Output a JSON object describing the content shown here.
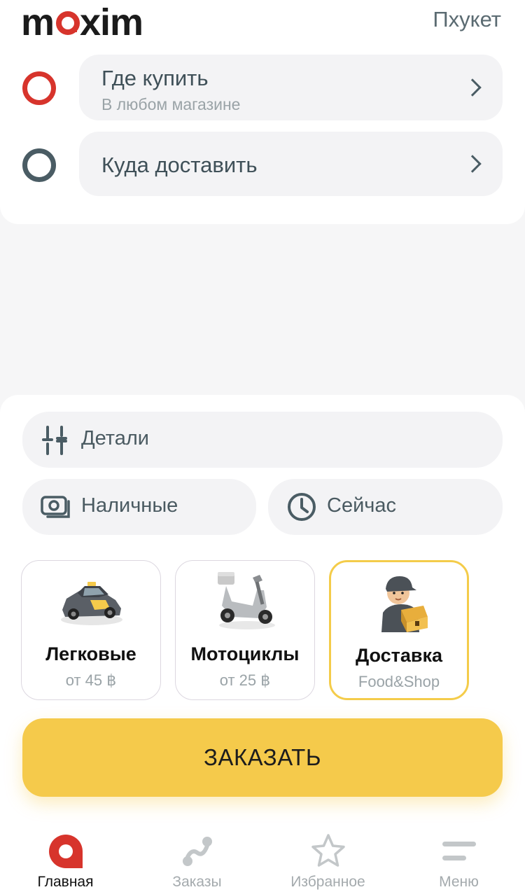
{
  "header": {
    "logo_text": "maxim",
    "city": "Пхукет"
  },
  "route": {
    "from": {
      "title": "Где купить",
      "subtitle": "В любом магазине"
    },
    "to": {
      "title": "Куда доставить"
    }
  },
  "options": {
    "details_label": "Детали",
    "payment_label": "Наличные",
    "time_label": "Сейчас"
  },
  "tariffs": [
    {
      "name": "Легковые",
      "price": "от 45 ฿",
      "icon": "car-icon"
    },
    {
      "name": "Мотоциклы",
      "price": "от 25 ฿",
      "icon": "scooter-icon"
    },
    {
      "name": "Доставка",
      "price": "Food&Shop",
      "icon": "courier-icon",
      "selected": true
    }
  ],
  "order_button": "ЗАКАЗАТЬ",
  "nav": [
    {
      "label": "Главная",
      "icon": "home-pin-icon",
      "active": true
    },
    {
      "label": "Заказы",
      "icon": "orders-route-icon"
    },
    {
      "label": "Избранное",
      "icon": "star-icon"
    },
    {
      "label": "Меню",
      "icon": "menu-icon"
    }
  ],
  "colors": {
    "brand_red": "#d7342c",
    "accent_yellow": "#f5ca4b",
    "dark_slate": "#4a5c64"
  }
}
